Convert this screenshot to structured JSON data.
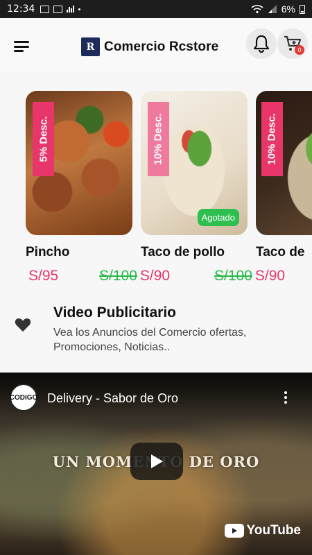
{
  "status_bar": {
    "time": "12:34",
    "battery": "6%"
  },
  "header": {
    "brand_logo_text": "R",
    "brand_name": "Comercio Rcstore",
    "cart_count": "0"
  },
  "products": [
    {
      "name": "Pincho",
      "discount": "5% Desc.",
      "old_price": "",
      "price": "S/95",
      "sold_out": ""
    },
    {
      "name": "Taco de pollo",
      "discount": "10% Desc.",
      "old_price": "S/100",
      "price": "S/90",
      "sold_out": "Agotado"
    },
    {
      "name": "Taco de",
      "discount": "10% Desc.",
      "old_price": "S/100",
      "price": "S/90",
      "sold_out": ""
    }
  ],
  "promo": {
    "title": "Video Publicitario",
    "description": "Vea los Anuncios del Comercio ofertas, Promociones, Noticias.."
  },
  "video": {
    "channel_avatar_text": "CODIGO",
    "title": "Delivery - Sabor de Oro",
    "overlay_text": "UN MOMENTO DE ORO",
    "provider": "YouTube"
  },
  "colors": {
    "discount_strong": "#e8356a",
    "discount_soft": "#f07a9e",
    "old_price": "#28b94a",
    "new_price": "#e8356a",
    "sold_out": "#2fbf4f",
    "cart_badge": "#e53935"
  },
  "icons": [
    "menu-icon",
    "bell-icon",
    "cart-icon",
    "heart-icon",
    "play-icon",
    "more-vert-icon",
    "youtube-icon"
  ]
}
